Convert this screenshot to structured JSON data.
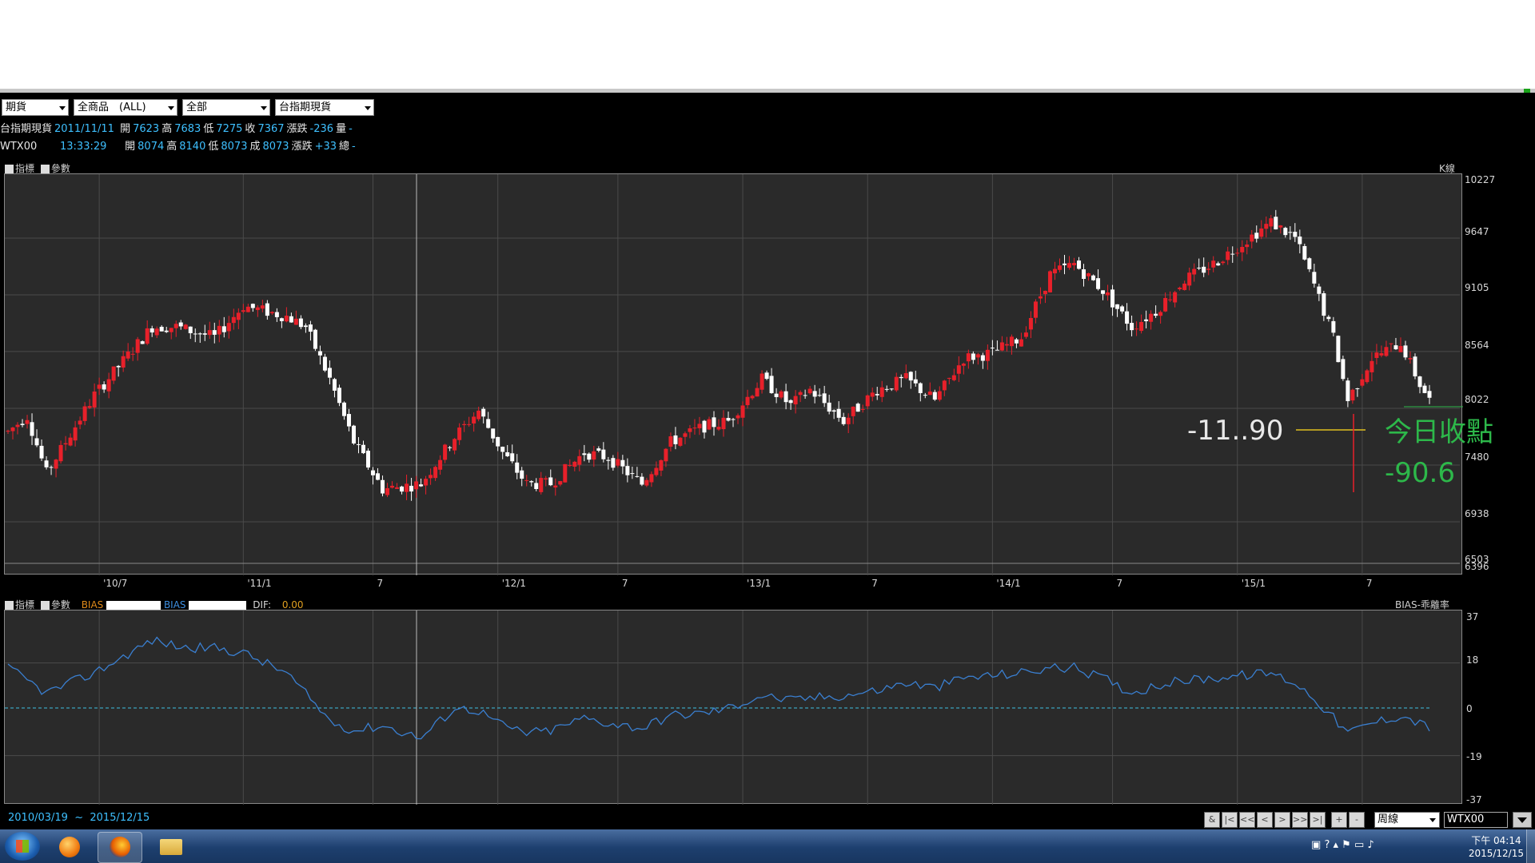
{
  "toolbar": {
    "dropdowns": [
      "期貨",
      "全商品　(ALL)",
      "全部",
      "台指期現貨"
    ]
  },
  "quote1": {
    "name": "台指期現貨",
    "date": "2011/11/11",
    "open_label": "開",
    "open": "7623",
    "high_label": "高",
    "high": "7683",
    "low_label": "低",
    "low": "7275",
    "close_label": "收",
    "close": "7367",
    "chg_label": "漲跌",
    "chg": "-236",
    "vol_label": "量",
    "vol": "-"
  },
  "quote2": {
    "name": "WTX00",
    "time": "13:33:29",
    "open_label": "開",
    "open": "8074",
    "high_label": "高",
    "high": "8140",
    "low_label": "低",
    "low": "8073",
    "close_label": "成",
    "close": "8073",
    "chg_label": "漲跌",
    "chg": "+33",
    "vol_label": "總",
    "vol": "-"
  },
  "top_panel": {
    "tab1": "指標",
    "tab2": "參數",
    "right_label": "K線"
  },
  "bottom_panel": {
    "tab1": "指標",
    "tab2": "參數",
    "bias1": "BIAS",
    "bias2": "BIAS",
    "dif_label": "DIF:",
    "dif_value": "0.00",
    "right_label": "BIAS-乖離率"
  },
  "annotations": {
    "left_value": "-11..90",
    "today_label": "今日收點",
    "today_value": "-90.6"
  },
  "chart_data": [
    {
      "type": "candlestick",
      "title": "K線",
      "ylim": [
        6503,
        10227
      ],
      "yticks": [
        "10227",
        "9647",
        "9105",
        "8564",
        "8022",
        "7480",
        "6938",
        "6503",
        "6396"
      ],
      "xticks": [
        "'10/7",
        "'11/1",
        "7",
        "'12/1",
        "7",
        "'13/1",
        "7",
        "'14/1",
        "7",
        "'15/1",
        "7"
      ],
      "trend_anchors": [
        [
          0,
          7800
        ],
        [
          4,
          7950
        ],
        [
          8,
          7400
        ],
        [
          18,
          8150
        ],
        [
          30,
          8800
        ],
        [
          35,
          8800
        ],
        [
          43,
          8700
        ],
        [
          49,
          9000
        ],
        [
          58,
          8900
        ],
        [
          62,
          8800
        ],
        [
          67,
          8300
        ],
        [
          72,
          7700
        ],
        [
          78,
          7250
        ],
        [
          86,
          7300
        ],
        [
          93,
          7750
        ],
        [
          98,
          8000
        ],
        [
          103,
          7600
        ],
        [
          108,
          7300
        ],
        [
          113,
          7300
        ],
        [
          120,
          7600
        ],
        [
          125,
          7550
        ],
        [
          132,
          7300
        ],
        [
          138,
          7700
        ],
        [
          145,
          7850
        ],
        [
          150,
          7900
        ],
        [
          157,
          8300
        ],
        [
          163,
          8050
        ],
        [
          167,
          8200
        ],
        [
          174,
          7900
        ],
        [
          181,
          8200
        ],
        [
          187,
          8300
        ],
        [
          193,
          8100
        ],
        [
          199,
          8500
        ],
        [
          205,
          8550
        ],
        [
          211,
          8700
        ],
        [
          217,
          9300
        ],
        [
          222,
          9400
        ],
        [
          228,
          9150
        ],
        [
          234,
          8800
        ],
        [
          239,
          8950
        ],
        [
          245,
          9250
        ],
        [
          251,
          9400
        ],
        [
          257,
          9600
        ],
        [
          263,
          9800
        ],
        [
          268,
          9650
        ],
        [
          272,
          9200
        ],
        [
          276,
          8700
        ],
        [
          279,
          8100
        ],
        [
          284,
          8500
        ],
        [
          290,
          8650
        ],
        [
          294,
          8250
        ],
        [
          296,
          8100
        ]
      ],
      "today_line_value": 8022
    },
    {
      "type": "line",
      "title": "BIAS-乖離率",
      "ylim": [
        -37,
        37
      ],
      "yticks": [
        "37",
        "18",
        "0",
        "-19",
        "-37"
      ],
      "zero_line": 0,
      "anchors": [
        [
          0,
          16
        ],
        [
          8,
          6
        ],
        [
          18,
          14
        ],
        [
          30,
          27
        ],
        [
          37,
          24
        ],
        [
          43,
          24
        ],
        [
          49,
          22
        ],
        [
          58,
          14
        ],
        [
          67,
          -5
        ],
        [
          72,
          -9
        ],
        [
          78,
          -7
        ],
        [
          86,
          -12
        ],
        [
          93,
          0
        ],
        [
          98,
          -1
        ],
        [
          103,
          -7
        ],
        [
          108,
          -10
        ],
        [
          113,
          -9
        ],
        [
          120,
          -4
        ],
        [
          125,
          -6
        ],
        [
          132,
          -8
        ],
        [
          138,
          -3
        ],
        [
          145,
          -2
        ],
        [
          150,
          0
        ],
        [
          157,
          5
        ],
        [
          163,
          3
        ],
        [
          167,
          4
        ],
        [
          174,
          5
        ],
        [
          181,
          7
        ],
        [
          187,
          10
        ],
        [
          193,
          8
        ],
        [
          199,
          12
        ],
        [
          205,
          13
        ],
        [
          211,
          14
        ],
        [
          217,
          16
        ],
        [
          222,
          16
        ],
        [
          228,
          12
        ],
        [
          234,
          6
        ],
        [
          239,
          9
        ],
        [
          245,
          11
        ],
        [
          251,
          12
        ],
        [
          257,
          13
        ],
        [
          263,
          14
        ],
        [
          268,
          10
        ],
        [
          272,
          4
        ],
        [
          276,
          -4
        ],
        [
          279,
          -10
        ],
        [
          284,
          -6
        ],
        [
          290,
          -3
        ],
        [
          294,
          -6
        ],
        [
          296,
          -8
        ]
      ]
    }
  ],
  "footer": {
    "range_start": "2010/03/19",
    "tilde": "~",
    "range_end": "2015/12/15",
    "nav": [
      "&",
      "|<",
      "<<",
      "<",
      ">",
      ">>",
      ">|",
      "+",
      "-"
    ],
    "period": "周線",
    "symbol": "WTX00"
  },
  "taskbar": {
    "time": "下午 04:14",
    "date": "2015/12/15"
  }
}
